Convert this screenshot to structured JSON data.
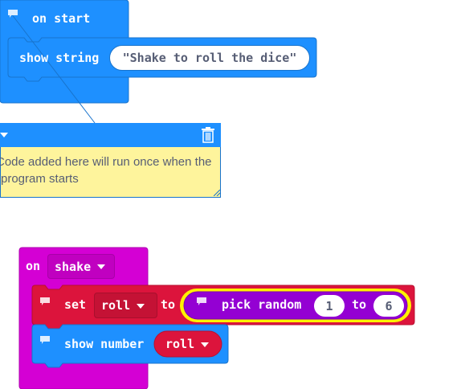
{
  "on_start": {
    "hat_label": "on start",
    "show_string_label": "show string",
    "string_value": "\"Shake to roll the dice\"",
    "comment_text": "Code added here will run once when the program starts"
  },
  "on_shake": {
    "hat_prefix": "on",
    "gesture_value": "shake",
    "set_label": "set",
    "variable_value": "roll",
    "to_label": "to",
    "pick_random_label": "pick random",
    "random_from": "1",
    "random_to_label": "to",
    "random_to": "6",
    "show_number_label": "show number",
    "show_number_variable": "roll"
  },
  "colors": {
    "basic_blue": "#1E90FF",
    "basic_blue_dark": "#1873CC",
    "input_magenta": "#D400D4",
    "variables_red": "#DC143C",
    "math_purple": "#9400D3",
    "highlight_yellow": "#FFF200",
    "comment_yellow": "#FEF49C",
    "text_gray": "#575E75"
  }
}
